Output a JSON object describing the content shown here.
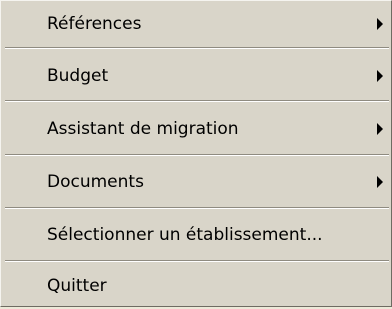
{
  "menu": {
    "items": [
      {
        "label": "Références",
        "has_submenu": true
      },
      {
        "label": "Budget",
        "has_submenu": true
      },
      {
        "label": "Assistant de migration",
        "has_submenu": true
      },
      {
        "label": "Documents",
        "has_submenu": true
      },
      {
        "label": "Sélectionner un établissement...",
        "has_submenu": false
      },
      {
        "label": "Quitter",
        "has_submenu": false
      }
    ]
  },
  "colors": {
    "menu_background": "#d9d5c9",
    "separator_shadow": "#8f8b80",
    "separator_highlight": "#ffffff"
  },
  "icons": {
    "submenu": "submenu-arrow-icon"
  }
}
